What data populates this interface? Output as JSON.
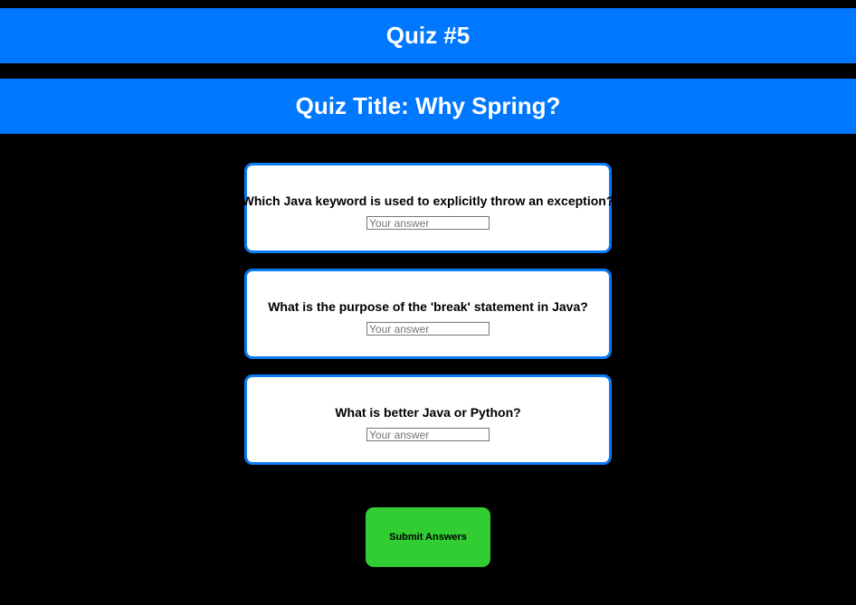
{
  "header": {
    "quiz_number": "Quiz #5",
    "quiz_title": "Quiz Title: Why Spring?"
  },
  "questions": [
    {
      "text": "Which Java keyword is used to explicitly throw an exception?",
      "answer_value": "",
      "answer_placeholder": "Your answer"
    },
    {
      "text": "What is the purpose of the 'break' statement in Java?",
      "answer_value": "",
      "answer_placeholder": "Your answer"
    },
    {
      "text": "What is better Java or Python?",
      "answer_value": "",
      "answer_placeholder": "Your answer"
    }
  ],
  "actions": {
    "submit_label": "Submit Answers"
  },
  "colors": {
    "background": "#000000",
    "banner": "#0077ff",
    "card_border": "#0a7af5",
    "submit_button": "#32cd32"
  }
}
